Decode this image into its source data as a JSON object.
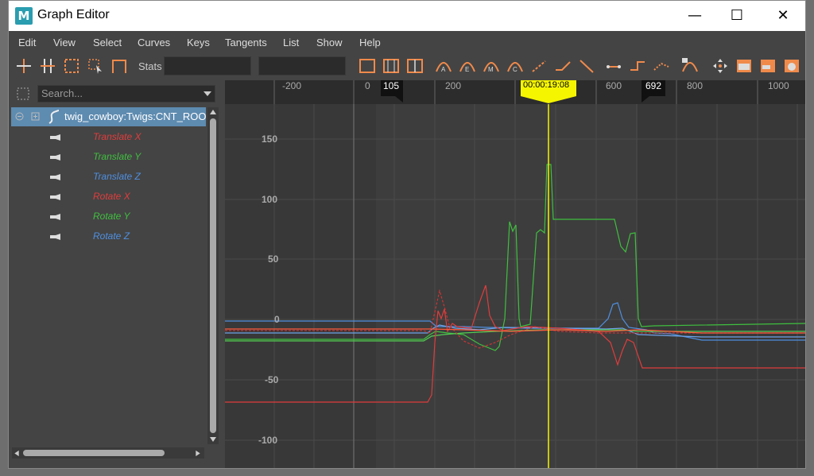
{
  "window": {
    "title": "Graph Editor",
    "app_icon": "M"
  },
  "window_buttons": {
    "minimize": "—",
    "maximize": "☐",
    "close": "✕"
  },
  "menu": [
    "Edit",
    "View",
    "Select",
    "Curves",
    "Keys",
    "Tangents",
    "List",
    "Show",
    "Help"
  ],
  "toolbar": {
    "stats_label": "Stats"
  },
  "outliner": {
    "search_placeholder": "Search...",
    "root_label": "twig_cowboy:Twigs:CNT_ROO",
    "attributes": [
      {
        "label": "Translate X",
        "color": "#e03c3c"
      },
      {
        "label": "Translate Y",
        "color": "#3fbf3f"
      },
      {
        "label": "Translate Z",
        "color": "#4f8fe0"
      },
      {
        "label": "Rotate X",
        "color": "#e03c3c"
      },
      {
        "label": "Rotate Y",
        "color": "#3fbf3f"
      },
      {
        "label": "Rotate Z",
        "color": "#4f8fe0"
      }
    ]
  },
  "timeline": {
    "ticks": [
      "-200",
      "0",
      "200",
      "400",
      "600",
      "800",
      "1000"
    ],
    "range_start": "105",
    "range_end": "692",
    "current_time": "00:00:19:08"
  },
  "graph": {
    "y_labels": [
      "150",
      "100",
      "50",
      "0",
      "-50",
      "-100"
    ]
  },
  "colors": {
    "accent_selection": "#5e8bb0",
    "current_time": "#f5f500"
  }
}
